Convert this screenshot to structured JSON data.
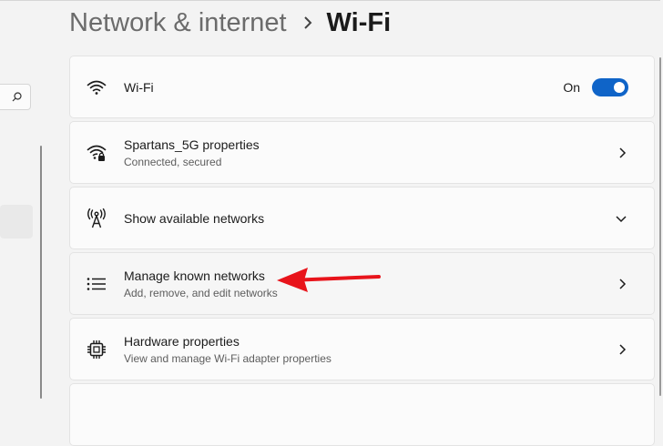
{
  "breadcrumb": {
    "parent": "Network & internet",
    "current": "Wi-Fi"
  },
  "wifi": {
    "title": "Wi-Fi",
    "toggle_label": "On",
    "toggle_state": true,
    "icon": "wifi-icon"
  },
  "connected": {
    "title": "Spartans_5G properties",
    "subtitle": "Connected, secured",
    "icon": "wifi-secured-icon"
  },
  "available": {
    "title": "Show available networks",
    "icon": "antenna-icon"
  },
  "known": {
    "title": "Manage known networks",
    "subtitle": "Add, remove, and edit networks",
    "icon": "list-icon"
  },
  "hardware": {
    "title": "Hardware properties",
    "subtitle": "View and manage Wi-Fi adapter properties",
    "icon": "chip-icon"
  },
  "colors": {
    "accent": "#0f64c8",
    "annotation": "#e8141b"
  }
}
